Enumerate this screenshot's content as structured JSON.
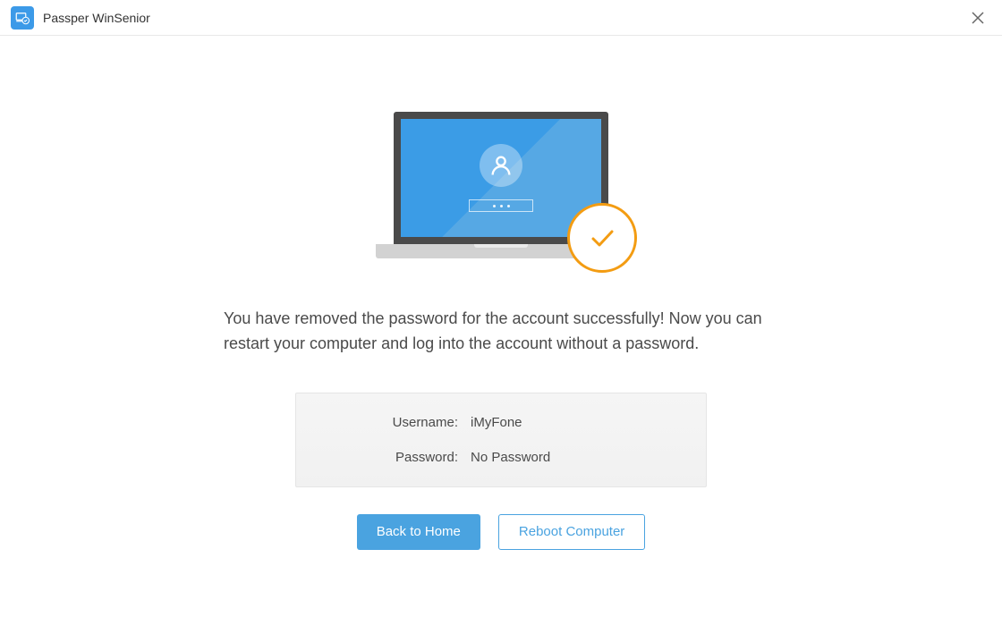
{
  "app": {
    "title": "Passper WinSenior"
  },
  "main": {
    "message": "You have removed the password for the account successfully! Now you can restart your computer and log into the account without a password.",
    "username_label": "Username:",
    "username_value": "iMyFone",
    "password_label": "Password:",
    "password_value": "No Password"
  },
  "buttons": {
    "back_home": "Back to Home",
    "reboot": "Reboot Computer"
  },
  "colors": {
    "accent": "#4aa3e0",
    "success": "#f39c12"
  }
}
